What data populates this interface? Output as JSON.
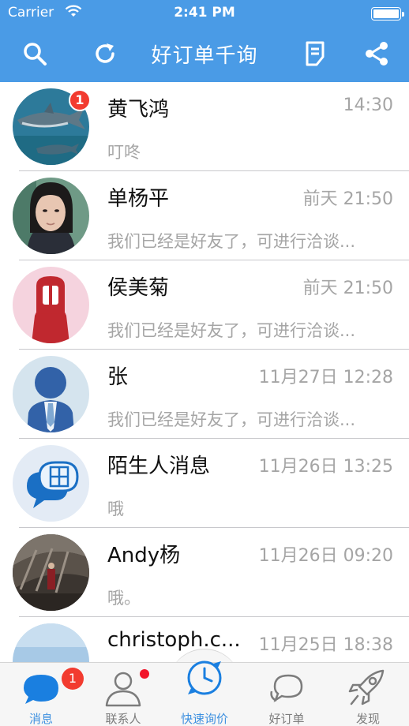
{
  "status_bar": {
    "carrier": "Carrier",
    "time": "2:41 PM"
  },
  "nav": {
    "title": "好订单千询",
    "left_icons": [
      "search-icon",
      "refresh-icon"
    ],
    "right_icons": [
      "order-list-icon",
      "share-icon"
    ]
  },
  "conversations": [
    {
      "name": "黄飞鸿",
      "time": "14:30",
      "preview": "叮咚",
      "avatar": "shark-photo",
      "unread": "1"
    },
    {
      "name": "单杨平",
      "time": "前天 21:50",
      "preview": "我们已经是好友了，可进行洽谈...",
      "avatar": "girl-photo"
    },
    {
      "name": "侯美菊",
      "time": "前天 21:50",
      "preview": "我们已经是好友了，可进行洽谈...",
      "avatar": "default-female"
    },
    {
      "name": "张",
      "time": "11月27日 12:28",
      "preview": "我们已经是好友了，可进行洽谈...",
      "avatar": "default-male"
    },
    {
      "name": "陌生人消息",
      "time": "11月26日 13:25",
      "preview": "哦",
      "avatar": "stranger-message"
    },
    {
      "name": "Andy杨",
      "time": "11月26日 09:20",
      "preview": "哦。",
      "avatar": "hall-photo"
    },
    {
      "name": "christoph.c...",
      "time": "11月25日 18:38",
      "preview": "",
      "avatar": "sky-photo"
    }
  ],
  "tabs": [
    {
      "label": "消息",
      "icon": "message-icon",
      "active": true,
      "badge": "1"
    },
    {
      "label": "联系人",
      "icon": "contacts-icon",
      "active": false,
      "dot": true
    },
    {
      "label": "快速询价",
      "icon": "quick-inquiry-icon",
      "active": true
    },
    {
      "label": "好订单",
      "icon": "orders-icon",
      "active": false
    },
    {
      "label": "发现",
      "icon": "discover-icon",
      "active": false
    }
  ],
  "colors": {
    "nav_bg": "#4a9be6",
    "accent": "#3f91e0",
    "badge": "#f23b2f",
    "secondary_text": "#a5a5a5"
  }
}
